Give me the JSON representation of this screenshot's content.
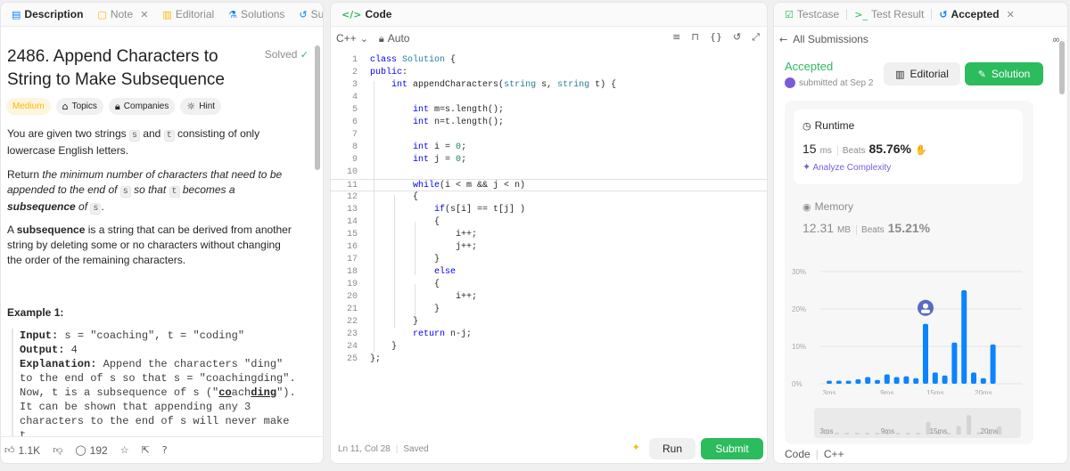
{
  "left_tabs": [
    {
      "label": "Description",
      "icon": "document-icon",
      "active": true
    },
    {
      "label": "Note",
      "icon": "note-icon",
      "active": false
    },
    {
      "label": "Editorial",
      "icon": "book-icon",
      "active": false
    },
    {
      "label": "Solutions",
      "icon": "flask-icon",
      "active": false
    },
    {
      "label": "Sub",
      "icon": "history-icon",
      "active": false
    }
  ],
  "problem": {
    "title": "2486. Append Characters to String to Make Subsequence",
    "solved_label": "Solved",
    "tags": [
      "Medium",
      "Topics",
      "Companies",
      "Hint"
    ],
    "p1_a": "You are given two strings ",
    "p1_s": "s",
    "p1_b": " and ",
    "p1_t": "t",
    "p1_c": " consisting of only lowercase English letters.",
    "p2_a": "Return ",
    "p2_b": "the minimum number of characters that need to be appended to the end of ",
    "p2_s": "s",
    "p2_c": " so that ",
    "p2_t": "t",
    "p2_d": " becomes a ",
    "p2_e": "subsequence",
    "p2_f": " of ",
    "p2_s2": "s",
    "p2_g": ".",
    "p3_a": "A ",
    "p3_b": "subsequence",
    "p3_c": " is a string that can be derived from another string by deleting some or no characters without changing the order of the remaining characters.",
    "example_head": "Example 1:",
    "ex_input_label": "Input:",
    "ex_input": " s = \"coaching\", t = \"coding\"",
    "ex_output_label": "Output:",
    "ex_output": " 4",
    "ex_expl_label": "Explanation:",
    "ex_expl_1": " Append the characters \"ding\" to the end of s so that s = \"coachingding\".",
    "ex_expl_2": "Now, t is a subsequence of s (\"",
    "ex_expl_bold1": "co",
    "ex_expl_3": "a",
    "ex_expl_bold2": "ding",
    "ex_expl_4": "ch",
    "ex_expl_5": "\").",
    "ex_expl_6": "It can be shown that appending any 3 characters to the end of s will never make t"
  },
  "left_footer": {
    "likes": "1.1K",
    "comments": "192"
  },
  "code_panel": {
    "tab_label": "Code",
    "language": "C++",
    "mode": "Auto",
    "status": "Ln 11, Col 28",
    "saved": "Saved",
    "run_label": "Run",
    "submit_label": "Submit"
  },
  "code_lines": [
    "class Solution {",
    "public:",
    "    int appendCharacters(string s, string t) {",
    "",
    "        int m=s.length();",
    "        int n=t.length();",
    "",
    "        int i = 0;",
    "        int j = 0;",
    "",
    "        while(i < m && j < n)",
    "        {",
    "            if(s[i] == t[j] )",
    "            {",
    "                i++;",
    "                j++;",
    "            }",
    "            else",
    "            {",
    "                i++;",
    "            }",
    "        }",
    "        return n-j;",
    "    }",
    "};"
  ],
  "right_tabs": [
    {
      "label": "Testcase",
      "icon": "check-box-icon"
    },
    {
      "label": "Test Result",
      "icon": "terminal-icon"
    },
    {
      "label": "Accepted",
      "icon": "history-icon"
    }
  ],
  "submission": {
    "back_label": "All Submissions",
    "status": "Accepted",
    "submitted_text": "submitted at Sep 2",
    "editorial_label": "Editorial",
    "solution_label": "Solution",
    "runtime_title": "Runtime",
    "runtime_value": "15",
    "runtime_unit": "ms",
    "beats_label": "Beats",
    "runtime_beats": "85.76%",
    "analyze_label": "Analyze Complexity",
    "memory_title": "Memory",
    "memory_value": "12.31",
    "memory_unit": "MB",
    "memory_beats": "15.21%",
    "code_label": "Code",
    "code_lang": "C++"
  },
  "colors": {
    "accent_green": "#2cbb5d",
    "bar_blue": "#0a84ff",
    "medium": "#ffb800"
  },
  "chart_data": {
    "type": "bar",
    "x": [
      2,
      3,
      4,
      5,
      6,
      7,
      8,
      9,
      10,
      11,
      12,
      13,
      14,
      15,
      16,
      17,
      18,
      19,
      20,
      21,
      22,
      23
    ],
    "values": [
      0.8,
      0.8,
      0.8,
      1.2,
      1.8,
      1.0,
      2.5,
      1.8,
      2.0,
      1.5,
      16,
      3,
      2.2,
      11,
      25,
      3,
      1.5,
      10.5
    ],
    "xtick_labels": [
      "3ms",
      "9ms",
      "15ms",
      "20ms"
    ],
    "ytick_labels": [
      "0%",
      "10%",
      "20%",
      "30%"
    ],
    "ylim": [
      0,
      30
    ],
    "grid": true,
    "highlight_label": "15ms"
  }
}
